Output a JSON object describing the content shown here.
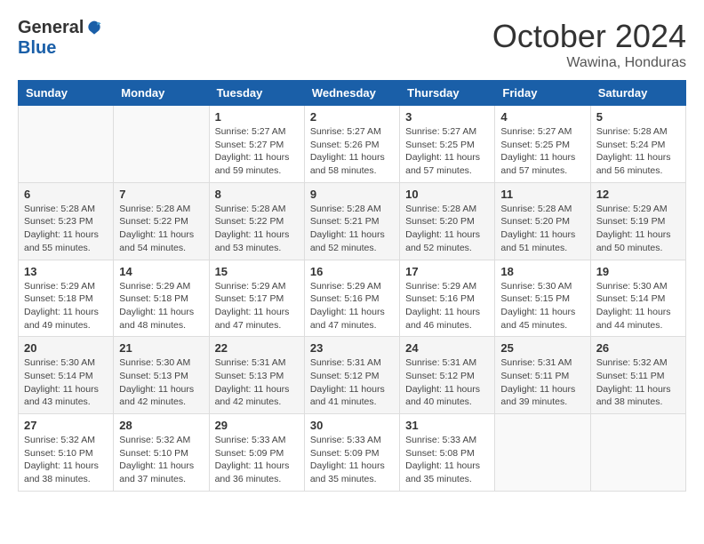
{
  "header": {
    "logo_general": "General",
    "logo_blue": "Blue",
    "month_title": "October 2024",
    "location": "Wawina, Honduras"
  },
  "calendar": {
    "days_of_week": [
      "Sunday",
      "Monday",
      "Tuesday",
      "Wednesday",
      "Thursday",
      "Friday",
      "Saturday"
    ],
    "weeks": [
      {
        "days": [
          {
            "number": "",
            "sunrise": "",
            "sunset": "",
            "daylight": ""
          },
          {
            "number": "",
            "sunrise": "",
            "sunset": "",
            "daylight": ""
          },
          {
            "number": "1",
            "sunrise": "Sunrise: 5:27 AM",
            "sunset": "Sunset: 5:27 PM",
            "daylight": "Daylight: 11 hours and 59 minutes."
          },
          {
            "number": "2",
            "sunrise": "Sunrise: 5:27 AM",
            "sunset": "Sunset: 5:26 PM",
            "daylight": "Daylight: 11 hours and 58 minutes."
          },
          {
            "number": "3",
            "sunrise": "Sunrise: 5:27 AM",
            "sunset": "Sunset: 5:25 PM",
            "daylight": "Daylight: 11 hours and 57 minutes."
          },
          {
            "number": "4",
            "sunrise": "Sunrise: 5:27 AM",
            "sunset": "Sunset: 5:25 PM",
            "daylight": "Daylight: 11 hours and 57 minutes."
          },
          {
            "number": "5",
            "sunrise": "Sunrise: 5:28 AM",
            "sunset": "Sunset: 5:24 PM",
            "daylight": "Daylight: 11 hours and 56 minutes."
          }
        ]
      },
      {
        "days": [
          {
            "number": "6",
            "sunrise": "Sunrise: 5:28 AM",
            "sunset": "Sunset: 5:23 PM",
            "daylight": "Daylight: 11 hours and 55 minutes."
          },
          {
            "number": "7",
            "sunrise": "Sunrise: 5:28 AM",
            "sunset": "Sunset: 5:22 PM",
            "daylight": "Daylight: 11 hours and 54 minutes."
          },
          {
            "number": "8",
            "sunrise": "Sunrise: 5:28 AM",
            "sunset": "Sunset: 5:22 PM",
            "daylight": "Daylight: 11 hours and 53 minutes."
          },
          {
            "number": "9",
            "sunrise": "Sunrise: 5:28 AM",
            "sunset": "Sunset: 5:21 PM",
            "daylight": "Daylight: 11 hours and 52 minutes."
          },
          {
            "number": "10",
            "sunrise": "Sunrise: 5:28 AM",
            "sunset": "Sunset: 5:20 PM",
            "daylight": "Daylight: 11 hours and 52 minutes."
          },
          {
            "number": "11",
            "sunrise": "Sunrise: 5:28 AM",
            "sunset": "Sunset: 5:20 PM",
            "daylight": "Daylight: 11 hours and 51 minutes."
          },
          {
            "number": "12",
            "sunrise": "Sunrise: 5:29 AM",
            "sunset": "Sunset: 5:19 PM",
            "daylight": "Daylight: 11 hours and 50 minutes."
          }
        ]
      },
      {
        "days": [
          {
            "number": "13",
            "sunrise": "Sunrise: 5:29 AM",
            "sunset": "Sunset: 5:18 PM",
            "daylight": "Daylight: 11 hours and 49 minutes."
          },
          {
            "number": "14",
            "sunrise": "Sunrise: 5:29 AM",
            "sunset": "Sunset: 5:18 PM",
            "daylight": "Daylight: 11 hours and 48 minutes."
          },
          {
            "number": "15",
            "sunrise": "Sunrise: 5:29 AM",
            "sunset": "Sunset: 5:17 PM",
            "daylight": "Daylight: 11 hours and 47 minutes."
          },
          {
            "number": "16",
            "sunrise": "Sunrise: 5:29 AM",
            "sunset": "Sunset: 5:16 PM",
            "daylight": "Daylight: 11 hours and 47 minutes."
          },
          {
            "number": "17",
            "sunrise": "Sunrise: 5:29 AM",
            "sunset": "Sunset: 5:16 PM",
            "daylight": "Daylight: 11 hours and 46 minutes."
          },
          {
            "number": "18",
            "sunrise": "Sunrise: 5:30 AM",
            "sunset": "Sunset: 5:15 PM",
            "daylight": "Daylight: 11 hours and 45 minutes."
          },
          {
            "number": "19",
            "sunrise": "Sunrise: 5:30 AM",
            "sunset": "Sunset: 5:14 PM",
            "daylight": "Daylight: 11 hours and 44 minutes."
          }
        ]
      },
      {
        "days": [
          {
            "number": "20",
            "sunrise": "Sunrise: 5:30 AM",
            "sunset": "Sunset: 5:14 PM",
            "daylight": "Daylight: 11 hours and 43 minutes."
          },
          {
            "number": "21",
            "sunrise": "Sunrise: 5:30 AM",
            "sunset": "Sunset: 5:13 PM",
            "daylight": "Daylight: 11 hours and 42 minutes."
          },
          {
            "number": "22",
            "sunrise": "Sunrise: 5:31 AM",
            "sunset": "Sunset: 5:13 PM",
            "daylight": "Daylight: 11 hours and 42 minutes."
          },
          {
            "number": "23",
            "sunrise": "Sunrise: 5:31 AM",
            "sunset": "Sunset: 5:12 PM",
            "daylight": "Daylight: 11 hours and 41 minutes."
          },
          {
            "number": "24",
            "sunrise": "Sunrise: 5:31 AM",
            "sunset": "Sunset: 5:12 PM",
            "daylight": "Daylight: 11 hours and 40 minutes."
          },
          {
            "number": "25",
            "sunrise": "Sunrise: 5:31 AM",
            "sunset": "Sunset: 5:11 PM",
            "daylight": "Daylight: 11 hours and 39 minutes."
          },
          {
            "number": "26",
            "sunrise": "Sunrise: 5:32 AM",
            "sunset": "Sunset: 5:11 PM",
            "daylight": "Daylight: 11 hours and 38 minutes."
          }
        ]
      },
      {
        "days": [
          {
            "number": "27",
            "sunrise": "Sunrise: 5:32 AM",
            "sunset": "Sunset: 5:10 PM",
            "daylight": "Daylight: 11 hours and 38 minutes."
          },
          {
            "number": "28",
            "sunrise": "Sunrise: 5:32 AM",
            "sunset": "Sunset: 5:10 PM",
            "daylight": "Daylight: 11 hours and 37 minutes."
          },
          {
            "number": "29",
            "sunrise": "Sunrise: 5:33 AM",
            "sunset": "Sunset: 5:09 PM",
            "daylight": "Daylight: 11 hours and 36 minutes."
          },
          {
            "number": "30",
            "sunrise": "Sunrise: 5:33 AM",
            "sunset": "Sunset: 5:09 PM",
            "daylight": "Daylight: 11 hours and 35 minutes."
          },
          {
            "number": "31",
            "sunrise": "Sunrise: 5:33 AM",
            "sunset": "Sunset: 5:08 PM",
            "daylight": "Daylight: 11 hours and 35 minutes."
          },
          {
            "number": "",
            "sunrise": "",
            "sunset": "",
            "daylight": ""
          },
          {
            "number": "",
            "sunrise": "",
            "sunset": "",
            "daylight": ""
          }
        ]
      }
    ]
  }
}
